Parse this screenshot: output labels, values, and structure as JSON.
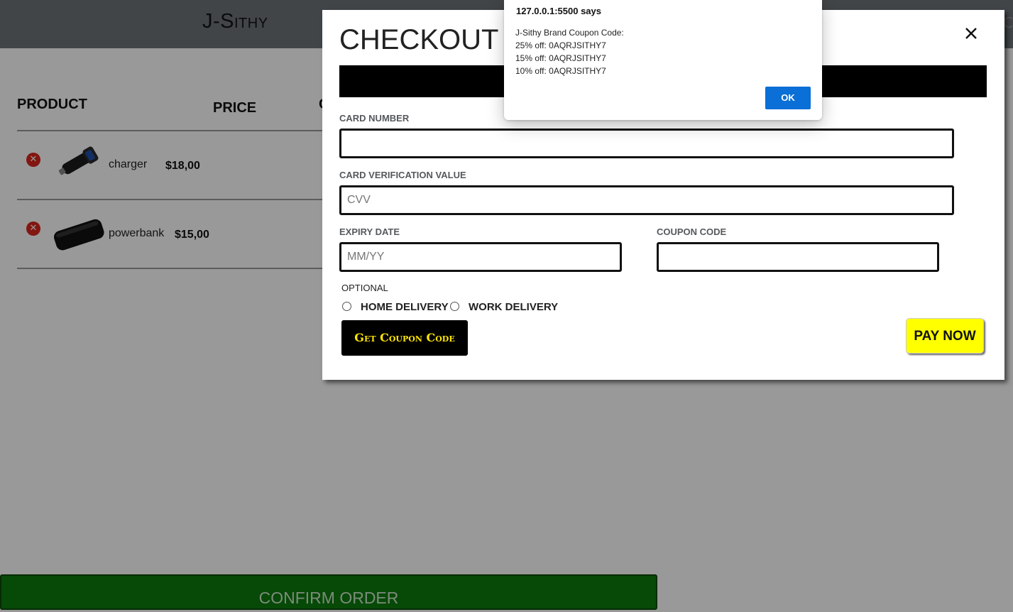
{
  "header": {
    "brand": "J-Sithy",
    "right_partial": "C"
  },
  "cart": {
    "columns": {
      "product": "PRODUCT",
      "price": "PRICE",
      "qty_partial": "C"
    },
    "items": [
      {
        "name": "charger",
        "price": "$18,00",
        "icon": "car-charger-image"
      },
      {
        "name": "powerbank",
        "price": "$15,00",
        "icon": "powerbank-image"
      }
    ],
    "confirm_label": "CONFIRM ORDER"
  },
  "checkout": {
    "title": "CHECKOUT",
    "card_number": {
      "label": "CARD NUMBER",
      "value": "",
      "placeholder": ""
    },
    "cvv": {
      "label": "CARD VERIFICATION VALUE",
      "value": "",
      "placeholder": "CVV"
    },
    "expiry": {
      "label": "EXPIRY DATE",
      "value": "",
      "placeholder": "MM/YY"
    },
    "coupon": {
      "label": "COUPON CODE",
      "value": "",
      "placeholder": ""
    },
    "optional_label": "OPTIONAL",
    "delivery_options": [
      "HOME DELIVERY",
      "WORK DELIVERY"
    ],
    "get_coupon_label": "Get Coupon Code",
    "pay_label": "PAY NOW"
  },
  "alert": {
    "origin": "127.0.0.1:5500 says",
    "lines": [
      "J-Sithy Brand Coupon Code:",
      "25% off: 0AQRJSITHY7",
      "15% off: 0AQRJSITHY7",
      "10% off: 0AQRJSITHY7"
    ],
    "ok_label": "OK"
  },
  "colors": {
    "topbar": "#6f7478",
    "confirm_green": "#0c7a0c",
    "coupon_text": "#ffe600",
    "pay_button": "#ffff00",
    "alert_ok": "#0a6fd6",
    "remove_red": "#d9251c",
    "qty_blue": "#1522c9"
  }
}
